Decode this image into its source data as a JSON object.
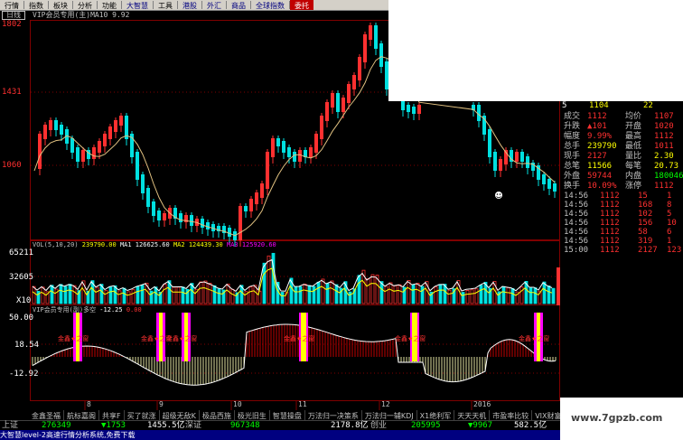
{
  "menu": [
    {
      "label": "行情",
      "style": ""
    },
    {
      "label": "指数",
      "style": ""
    },
    {
      "label": "板块",
      "style": ""
    },
    {
      "label": "分析",
      "style": ""
    },
    {
      "label": "功能",
      "style": ""
    },
    {
      "label": "大智慧",
      "style": "blue"
    },
    {
      "label": "工具",
      "style": ""
    },
    {
      "label": "港股",
      "style": "blue"
    },
    {
      "label": "外汇",
      "style": "blue"
    },
    {
      "label": "商品",
      "style": "blue"
    },
    {
      "label": "全球指数",
      "style": "blue"
    },
    {
      "label": "委托",
      "style": "red"
    }
  ],
  "period_button": "日线",
  "main_chart": {
    "caption": "VIP会员专用(主)MA10 9.92",
    "y_labels": [
      "1802",
      "1431",
      "1060"
    ],
    "colors": {
      "up": "#ff3030",
      "down": "#00e0e0",
      "ma": "#e0c080",
      "grid": "#800000"
    }
  },
  "volume_chart": {
    "caption_prefix": "VOL(5,10,20)",
    "caption_value": "239790.00",
    "ma1": "MA1 126625.60",
    "ma2": "MA2 124439.30",
    "ma3": "MA3 125920.60",
    "y_labels": [
      "65211",
      "32605",
      "X10"
    ]
  },
  "indicator_chart": {
    "caption": "VIP会员专用(副)多空",
    "value": "-12.25",
    "value2": "0.00",
    "y_labels": [
      "50.00",
      "18.54",
      "-12.92"
    ],
    "signal_label": "金鑫★之窗"
  },
  "x_axis": [
    "8",
    "9",
    "10",
    "11",
    "12",
    "2016"
  ],
  "quote_panel": {
    "header": {
      "a": "5",
      "b": "1104",
      "c": "22"
    },
    "rows": [
      {
        "l1": "成交",
        "v1": "1112",
        "l2": "均价",
        "v2": "1107"
      },
      {
        "l1": "升跌",
        "v1": "▲101",
        "l2": "开盘",
        "v2": "1020"
      },
      {
        "l1": "幅度",
        "v1": "9.99%",
        "l2": "最高",
        "v2": "1112"
      },
      {
        "l1": "总手",
        "v1": "239790",
        "l2": "最低",
        "v2": "1011"
      },
      {
        "l1": "现手",
        "v1": "2127",
        "l2": "量比",
        "v2": "2.30"
      },
      {
        "l1": "总笔",
        "v1": "11566",
        "l2": "每笔",
        "v2": "20.73"
      },
      {
        "l1": "外盘",
        "v1": "59744",
        "l2": "内盘",
        "v2": "180046"
      },
      {
        "l1": "换手",
        "v1": "10.09%",
        "l2": "涨停",
        "v2": "1112"
      }
    ],
    "ticks": [
      {
        "t": "14:56",
        "p": "1112",
        "v": "15",
        "d": "1"
      },
      {
        "t": "14:56",
        "p": "1112",
        "v": "168",
        "d": "8"
      },
      {
        "t": "14:56",
        "p": "1112",
        "v": "102",
        "d": "5"
      },
      {
        "t": "14:56",
        "p": "1112",
        "v": "156",
        "d": "10"
      },
      {
        "t": "14:56",
        "p": "1112",
        "v": "58",
        "d": "6"
      },
      {
        "t": "14:56",
        "p": "1112",
        "v": "319",
        "d": "1"
      },
      {
        "t": "15:00",
        "p": "1112",
        "v": "2127",
        "d": "123"
      }
    ]
  },
  "tabs": [
    "金鑫圣福",
    "航标嘉阁",
    "共享F",
    "买了就涨",
    "超级无敌K",
    "极品西施",
    "极光旧生",
    "智慧操盘",
    "万法归一决策系",
    "万法归一辅KDJ",
    "X1绝利军",
    "天天天机",
    "市盈率比较",
    "VIX财富通"
  ],
  "statusbar": {
    "sh_label": "上证",
    "sh_value": "276349",
    "sh_change": "▼1753",
    "sh_amount": "1455.5亿",
    "sz_label": "深证",
    "sz_value": "967348",
    "sz_amount": "2178.8亿",
    "cy_label": "创业",
    "cy_value": "205995",
    "cy_change": "▼9967",
    "cy_amount": "582.5亿"
  },
  "ticker": "大智慧level-2高速行情分析系统,免费下载",
  "watermark": "www.7gpzb.com"
}
